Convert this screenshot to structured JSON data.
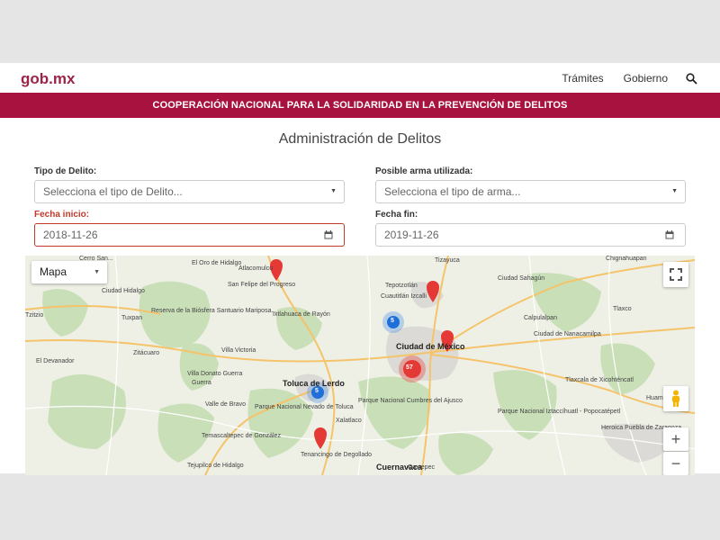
{
  "header": {
    "logo": "gob",
    "logo_tld": ".mx",
    "nav": [
      "Trámites",
      "Gobierno"
    ],
    "search_icon": "search-icon"
  },
  "banner": {
    "text": "COOPERACIÓN NACIONAL PARA LA SOLIDARIDAD EN LA PREVENCIÓN DE DELITOS"
  },
  "page": {
    "title": "Administración de Delitos"
  },
  "form": {
    "tipo_delito": {
      "label": "Tipo de Delito:",
      "value": "Selecciona el tipo de Delito..."
    },
    "arma": {
      "label": "Posible arma utilizada:",
      "value": "Selecciona el tipo de arma..."
    },
    "fecha_inicio": {
      "label": "Fecha inicio:",
      "value": "2018-11-26"
    },
    "fecha_fin": {
      "label": "Fecha fin:",
      "value": "2019-11-26"
    }
  },
  "map": {
    "type_control": "Mapa",
    "zoom_in": "+",
    "zoom_out": "−",
    "clusters": [
      {
        "name": "cluster-blue",
        "count": "5"
      },
      {
        "name": "cluster-blue-toluca",
        "count": "5"
      },
      {
        "name": "cluster-red-cdmx",
        "count": "57"
      }
    ],
    "places": [
      {
        "name": "Ciudad de México",
        "kind": "city"
      },
      {
        "name": "Toluca de Lerdo",
        "kind": "city"
      },
      {
        "name": "Cuernavaca",
        "kind": "city"
      },
      {
        "name": "Tizayuca"
      },
      {
        "name": "Tepotzotlán"
      },
      {
        "name": "Cuautitlán Izcalli"
      },
      {
        "name": "Atlacomulco"
      },
      {
        "name": "San Felipe del Progreso"
      },
      {
        "name": "Ixtlahuaca de Rayón"
      },
      {
        "name": "Villa Victoria"
      },
      {
        "name": "Valle de Bravo"
      },
      {
        "name": "Temascaltepec de González"
      },
      {
        "name": "Tejupilco de Hidalgo"
      },
      {
        "name": "Tenancingo de Degollado"
      },
      {
        "name": "Parque Nacional Nevado de Toluca"
      },
      {
        "name": "Parque Nacional Cumbres del Ajusco"
      },
      {
        "name": "Parque Nacional Iztaccíhuatl - Popocatépetl"
      },
      {
        "name": "Reserva de la Biósfera Santuario Mariposa..."
      },
      {
        "name": "Tlaxco"
      },
      {
        "name": "Calpulalpan"
      },
      {
        "name": "Ciudad de Nanacamilpa"
      },
      {
        "name": "Tlaxcala de Xicohténcatl"
      },
      {
        "name": "Heroica Puebla de Zaragoza"
      },
      {
        "name": "Chignahuapan"
      },
      {
        "name": "Ciudad Sahagún"
      },
      {
        "name": "Huamantla"
      },
      {
        "name": "Oaxtepec"
      },
      {
        "name": "Cerro San..."
      },
      {
        "name": "Ciudad Hidalgo"
      },
      {
        "name": "Tuxpan"
      },
      {
        "name": "El Oro de Hidalgo"
      },
      {
        "name": "Tzitzio"
      },
      {
        "name": "El Devanador"
      },
      {
        "name": "Zitácuaro"
      },
      {
        "name": "Villa Donato Guerra"
      },
      {
        "name": "Guerra"
      },
      {
        "name": "Xalatlaco"
      }
    ]
  }
}
